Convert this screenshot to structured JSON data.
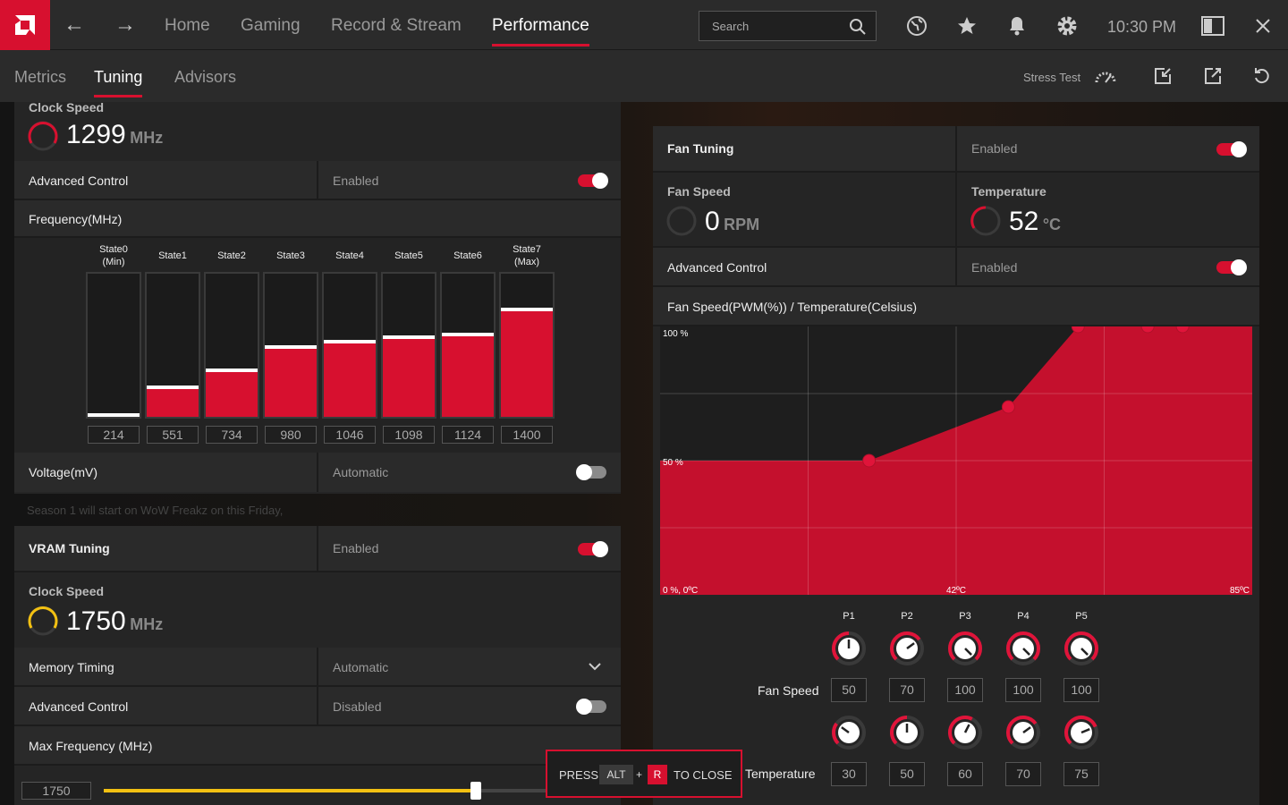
{
  "nav": {
    "tabs": [
      "Home",
      "Gaming",
      "Record & Stream",
      "Performance"
    ],
    "active": "Performance",
    "search_placeholder": "Search",
    "time": "10:30 PM"
  },
  "subnav": {
    "tabs": [
      "Metrics",
      "Tuning",
      "Advisors"
    ],
    "active": "Tuning",
    "stress_test": "Stress Test"
  },
  "gpu": {
    "clock_label": "Clock Speed",
    "clock_value": "1299",
    "clock_unit": "MHz",
    "advanced_control": {
      "label": "Advanced Control",
      "value": "Enabled",
      "on": true
    },
    "frequency_label": "Frequency(MHz)",
    "states": [
      {
        "label": "State0\n(Min)",
        "value": "214",
        "fill": 0.0
      },
      {
        "label": "State1",
        "value": "551",
        "fill": 0.22
      },
      {
        "label": "State2",
        "value": "734",
        "fill": 0.34
      },
      {
        "label": "State3",
        "value": "980",
        "fill": 0.5
      },
      {
        "label": "State4",
        "value": "1046",
        "fill": 0.54
      },
      {
        "label": "State5",
        "value": "1098",
        "fill": 0.57
      },
      {
        "label": "State6",
        "value": "1124",
        "fill": 0.59
      },
      {
        "label": "State7\n(Max)",
        "value": "1400",
        "fill": 0.76
      }
    ],
    "voltage": {
      "label": "Voltage(mV)",
      "value": "Automatic",
      "on": false
    },
    "bg_text": "Season 1 will start on WoW Freakz on this Friday,"
  },
  "vram": {
    "title": "VRAM Tuning",
    "value": "Enabled",
    "on": true,
    "clock_label": "Clock Speed",
    "clock_value": "1750",
    "clock_unit": "MHz",
    "memory_timing": {
      "label": "Memory Timing",
      "value": "Automatic"
    },
    "advanced_control": {
      "label": "Advanced Control",
      "value": "Disabled",
      "on": false
    },
    "max_freq": {
      "label": "Max Frequency (MHz)",
      "value": "1750",
      "fill": 0.8
    }
  },
  "fan": {
    "title": "Fan Tuning",
    "value": "Enabled",
    "on": true,
    "speed_label": "Fan Speed",
    "speed_value": "0",
    "speed_unit": "RPM",
    "temp_label": "Temperature",
    "temp_value": "52",
    "temp_unit": "°C",
    "advanced_control": {
      "label": "Advanced Control",
      "value": "Enabled",
      "on": true
    },
    "chart_label": "Fan Speed(PWM(%)) / Temperature(Celsius)",
    "chart_axis": {
      "y100": "100 %",
      "y50": "50 %",
      "origin": "0 %, 0ºC",
      "x_mid": "42ºC",
      "x_max": "85ºC"
    },
    "points": [
      "P1",
      "P2",
      "P3",
      "P4",
      "P5"
    ],
    "fan_speed_row_label": "Fan Speed",
    "temperature_row_label": "Temperature",
    "fan_speeds": [
      "50",
      "70",
      "100",
      "100",
      "100"
    ],
    "temperatures": [
      "30",
      "50",
      "60",
      "70",
      "75"
    ]
  },
  "chart_data": {
    "type": "area",
    "x": [
      0,
      30,
      50,
      60,
      70,
      75,
      85
    ],
    "y": [
      50,
      50,
      70,
      100,
      100,
      100,
      100
    ],
    "xlim": [
      0,
      85
    ],
    "ylim": [
      0,
      100
    ],
    "xlabel": "Temperature(Celsius)",
    "ylabel": "Fan Speed(PWM(%))",
    "series": [
      {
        "values": [
          50,
          50,
          70,
          100,
          100,
          100,
          100
        ]
      }
    ],
    "points": [
      {
        "x": 30,
        "y": 50
      },
      {
        "x": 50,
        "y": 70
      },
      {
        "x": 60,
        "y": 100
      },
      {
        "x": 70,
        "y": 100
      },
      {
        "x": 75,
        "y": 100
      }
    ]
  },
  "overlay": {
    "press": "PRESS",
    "alt": "ALT",
    "plus": "+",
    "r": "R",
    "close": "TO CLOSE"
  },
  "colors": {
    "accent": "#d7102f",
    "vram_accent": "#f2c012"
  }
}
